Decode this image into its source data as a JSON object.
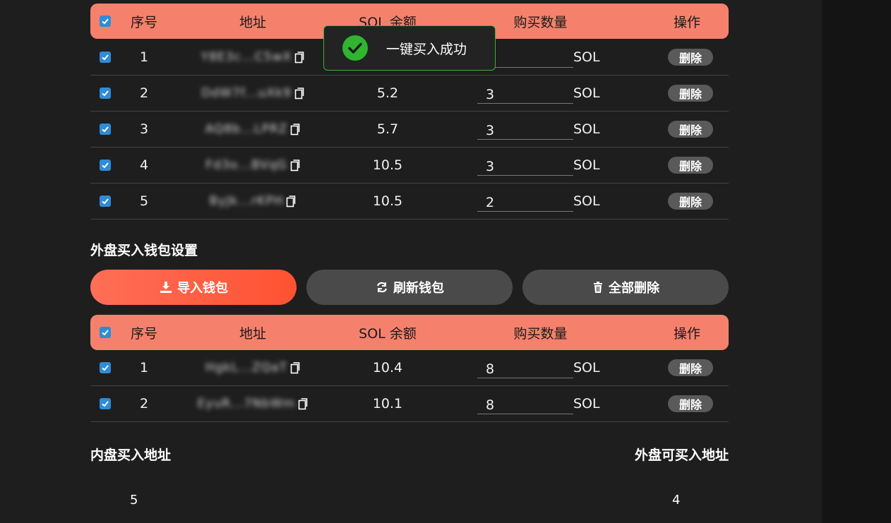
{
  "table_headers": {
    "index": "序号",
    "address": "地址",
    "balance": "SOL 余额",
    "quantity": "购买数量",
    "action": "操作"
  },
  "inner_wallets": [
    {
      "index": "1",
      "address": "Y8E3c...C5wX",
      "balance": "",
      "quantity": "",
      "unit": "SOL",
      "delete_label": "删除"
    },
    {
      "index": "2",
      "address": "DdW7f...uXk9",
      "balance": "5.2",
      "quantity": "3",
      "unit": "SOL",
      "delete_label": "删除"
    },
    {
      "index": "3",
      "address": "AQ8b...LPRZ",
      "balance": "5.7",
      "quantity": "3",
      "unit": "SOL",
      "delete_label": "删除"
    },
    {
      "index": "4",
      "address": "Fd3o...BVqG",
      "balance": "10.5",
      "quantity": "3",
      "unit": "SOL",
      "delete_label": "删除"
    },
    {
      "index": "5",
      "address": "ByJk...rKPH",
      "balance": "10.5",
      "quantity": "2",
      "unit": "SOL",
      "delete_label": "删除"
    }
  ],
  "outer_section_title": "外盘买入钱包设置",
  "actions": {
    "import_label": "导入钱包",
    "refresh_label": "刷新钱包",
    "delete_all_label": "全部删除"
  },
  "outer_wallets": [
    {
      "index": "1",
      "address": "HgkL...ZQaT",
      "balance": "10.4",
      "quantity": "8",
      "unit": "SOL",
      "delete_label": "删除"
    },
    {
      "index": "2",
      "address": "EyuR...7NbWm",
      "balance": "10.1",
      "quantity": "8",
      "unit": "SOL",
      "delete_label": "删除"
    }
  ],
  "summary": {
    "inner_label": "内盘买入地址",
    "inner_count": "5",
    "outer_label": "外盘可买入地址",
    "outer_count": "4"
  },
  "toast": {
    "message": "一键买入成功"
  },
  "colors": {
    "accent": "#f5816d",
    "primary_button": "#ff5a3c",
    "success": "#2fb52f",
    "checkbox": "#2f8cd6"
  }
}
